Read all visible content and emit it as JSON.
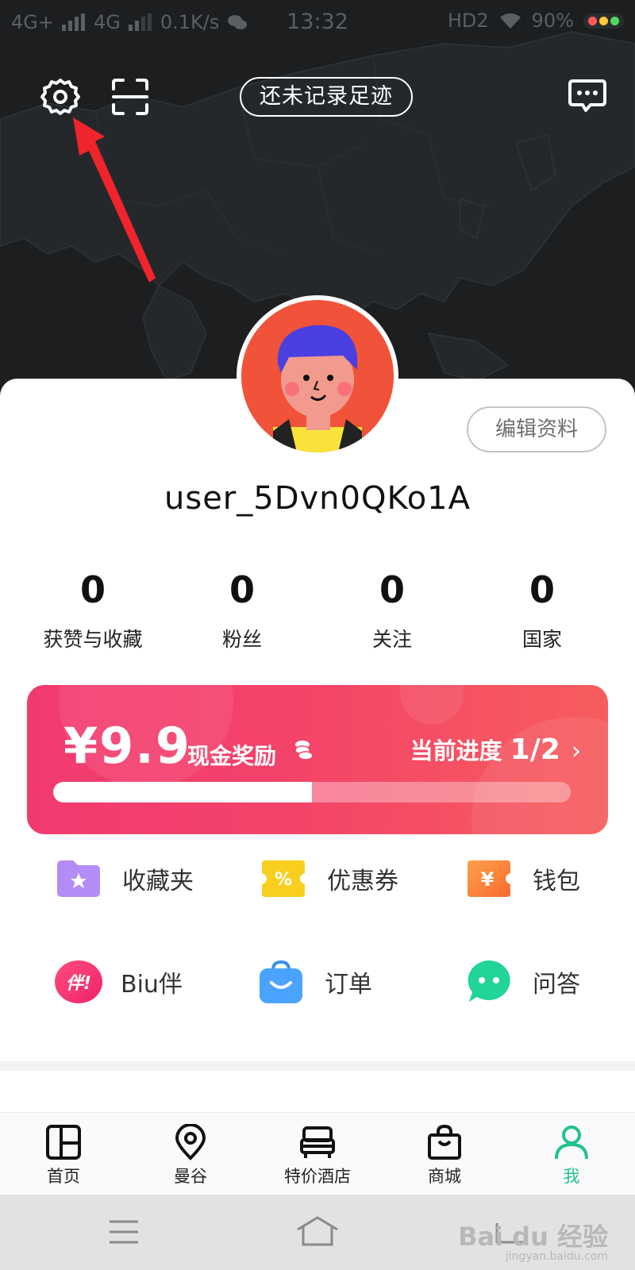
{
  "status_bar": {
    "network_1": "4G+",
    "network_2": "4G",
    "speed": "0.1K/s",
    "time": "13:32",
    "hd": "HD2",
    "battery": "90%"
  },
  "header": {
    "footprint_button": "还未记录足迹",
    "icons": [
      "settings-icon",
      "scan-icon",
      "message-icon"
    ]
  },
  "profile": {
    "username": "user_5Dvn0QKo1A",
    "edit_button": "编辑资料",
    "stats": [
      {
        "value": "0",
        "label": "获赞与收藏"
      },
      {
        "value": "0",
        "label": "粉丝"
      },
      {
        "value": "0",
        "label": "关注"
      },
      {
        "value": "0",
        "label": "国家"
      }
    ]
  },
  "reward": {
    "price": "¥9.9",
    "cash_label": "现金奖励",
    "progress_label": "当前进度",
    "progress_text": "1/2",
    "progress_fraction": 0.5,
    "colors": {
      "start": "#f23a70",
      "end": "#f65d5c"
    }
  },
  "features": [
    {
      "label": "收藏夹",
      "icon": "folder-star-icon",
      "color": "#b48cf5"
    },
    {
      "label": "优惠券",
      "icon": "coupon-icon",
      "color": "#f9cf1f"
    },
    {
      "label": "钱包",
      "icon": "wallet-icon",
      "color": "#fb8a3c"
    },
    {
      "label": "Biu伴",
      "icon": "biu-icon",
      "color": "#f43a6c"
    },
    {
      "label": "订单",
      "icon": "order-bag-icon",
      "color": "#4aa3ff"
    },
    {
      "label": "问答",
      "icon": "chat-bubble-icon",
      "color": "#22d39a"
    }
  ],
  "coupon_glyph": "%",
  "wallet_glyph": "¥",
  "biu_glyph": "伴!",
  "tabs": [
    {
      "label": "首页",
      "icon": "home-grid-icon"
    },
    {
      "label": "曼谷",
      "icon": "location-pin-icon"
    },
    {
      "label": "特价酒店",
      "icon": "hotel-bed-icon"
    },
    {
      "label": "商城",
      "icon": "shopping-bag-icon"
    },
    {
      "label": "我",
      "icon": "person-icon",
      "active": true
    }
  ],
  "watermark": {
    "main": "Bai du 经验",
    "sub": "jingyan.baidu.com"
  },
  "accent_color": "#22c28e"
}
